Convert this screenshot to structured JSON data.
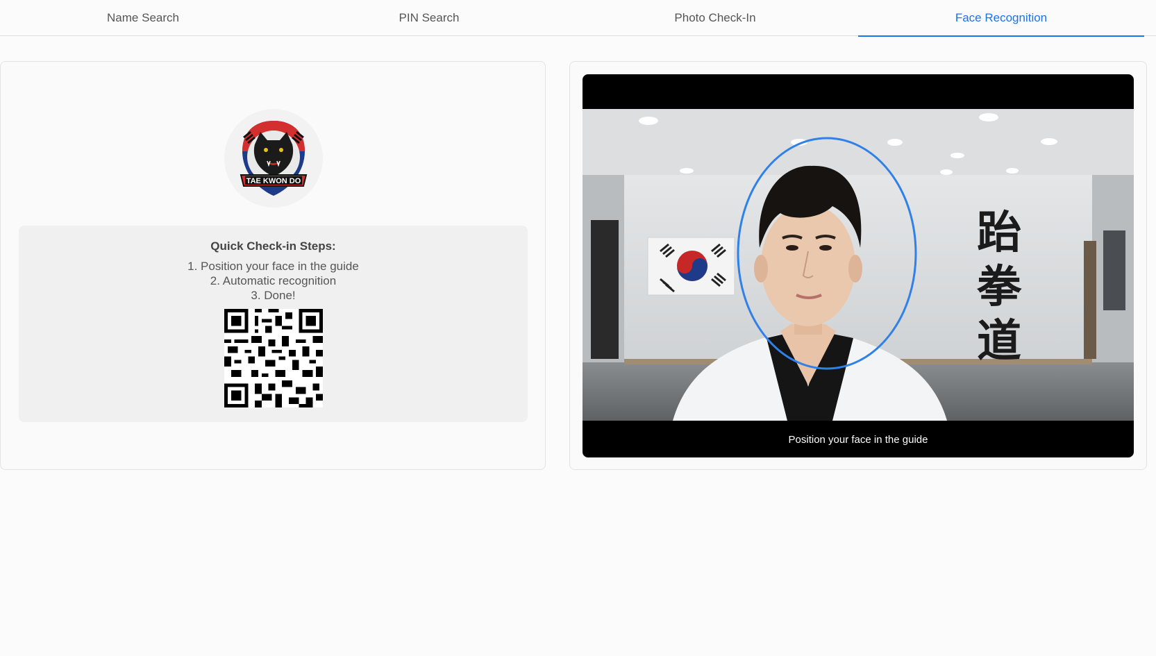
{
  "tabs": [
    {
      "label": "Name Search",
      "active": false
    },
    {
      "label": "PIN Search",
      "active": false
    },
    {
      "label": "Photo Check-In",
      "active": false
    },
    {
      "label": "Face Recognition",
      "active": true
    }
  ],
  "logo": {
    "text": "TAE KWON DO"
  },
  "steps": {
    "title": "Quick Check-in Steps:",
    "items": [
      "1. Position your face in the guide",
      "2. Automatic recognition",
      "3. Done!"
    ]
  },
  "camera": {
    "hint": "Position your face in the guide",
    "wall_text": [
      "跆",
      "拳",
      "道"
    ]
  },
  "colors": {
    "accent": "#1a73e8",
    "guide_ring": "#2f80e8"
  }
}
